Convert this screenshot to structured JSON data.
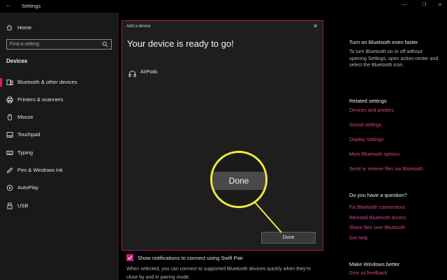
{
  "window": {
    "app_title": "Settings",
    "back_icon": "back-arrow-icon",
    "controls": [
      "minimize-icon",
      "maximize-icon",
      "close-icon"
    ]
  },
  "sidebar": {
    "home_label": "Home",
    "search_placeholder": "Find a setting",
    "section_title": "Devices",
    "items": [
      {
        "label": "Bluetooth & other devices",
        "icon": "bluetooth-devices-icon",
        "active": true
      },
      {
        "label": "Printers & scanners",
        "icon": "printer-icon",
        "active": false
      },
      {
        "label": "Mouse",
        "icon": "mouse-icon",
        "active": false
      },
      {
        "label": "Touchpad",
        "icon": "touchpad-icon",
        "active": false
      },
      {
        "label": "Typing",
        "icon": "keyboard-icon",
        "active": false
      },
      {
        "label": "Pen & Windows Ink",
        "icon": "pen-icon",
        "active": false
      },
      {
        "label": "AutoPlay",
        "icon": "autoplay-icon",
        "active": false
      },
      {
        "label": "USB",
        "icon": "usb-icon",
        "active": false
      }
    ]
  },
  "main": {
    "swift_pair_label": "Show notifications to connect using Swift Pair",
    "swift_pair_checked": true,
    "swift_pair_desc": "When selected, you can connect to supported Bluetooth devices quickly when they're close by and in pairing mode."
  },
  "right_panel": {
    "bt_faster_heading": "Turn on Bluetooth even faster",
    "bt_faster_text": "To turn Bluetooth on or off without opening Settings, open action center and select the Bluetooth icon.",
    "related_heading": "Related settings",
    "related_links": [
      "Devices and printers",
      "Sound settings",
      "Display settings",
      "More Bluetooth options",
      "Send or receive files via Bluetooth"
    ],
    "question_heading": "Do you have a question?",
    "question_links": [
      "Fix Bluetooth connections",
      "Reinstall Bluetooth drivers",
      "Share files over Bluetooth",
      "Get help"
    ],
    "better_heading": "Make Windows better",
    "better_links": [
      "Give us feedback"
    ]
  },
  "dialog": {
    "title": "Add a device",
    "close_glyph": "✕",
    "heading": "Your device is ready to go!",
    "device_name": "AirPods",
    "device_icon": "headphones-icon",
    "done_label": "Done"
  },
  "callout": {
    "label": "Done",
    "color": "#f2ea3c"
  },
  "colors": {
    "accent": "#c81d7a",
    "link": "#d64594",
    "callout": "#f2ea3c"
  }
}
